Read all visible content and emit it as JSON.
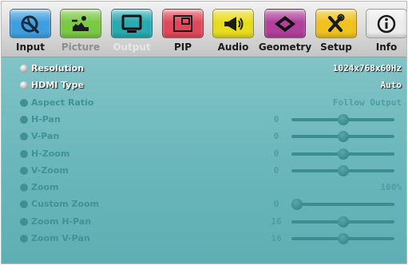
{
  "tabs": [
    {
      "id": "input",
      "label": "Input",
      "icon": "input-arrow-icon",
      "color": "#3e9fe0",
      "state": "normal"
    },
    {
      "id": "picture",
      "label": "Picture",
      "icon": "picture-adjust-icon",
      "color": "#7ac943",
      "state": "dim"
    },
    {
      "id": "output",
      "label": "Output",
      "icon": "monitor-icon",
      "color": "#27aab0",
      "state": "active"
    },
    {
      "id": "pip",
      "label": "PIP",
      "icon": "pip-window-icon",
      "color": "#e0485a",
      "state": "normal"
    },
    {
      "id": "audio",
      "label": "Audio",
      "icon": "speaker-icon",
      "color": "#e8dc1e",
      "state": "normal"
    },
    {
      "id": "geometry",
      "label": "Geometry",
      "icon": "geometry-icon",
      "color": "#b0409b",
      "state": "normal"
    },
    {
      "id": "setup",
      "label": "Setup",
      "icon": "tools-icon",
      "color": "#f0c21e",
      "state": "normal"
    },
    {
      "id": "info",
      "label": "Info",
      "icon": "info-icon",
      "color": "#ececec",
      "state": "normal"
    }
  ],
  "menu": {
    "rows": [
      {
        "name": "Resolution",
        "value": "1024x768x60Hz",
        "enabled": true,
        "type": "value"
      },
      {
        "name": "HDMI Type",
        "value": "Auto",
        "enabled": true,
        "type": "value"
      },
      {
        "name": "Aspect Ratio",
        "value": "Follow Output",
        "enabled": false,
        "type": "value"
      },
      {
        "name": "H-Pan",
        "value": "0",
        "enabled": false,
        "type": "slider",
        "level": 0.5
      },
      {
        "name": "V-Pan",
        "value": "0",
        "enabled": false,
        "type": "slider",
        "level": 0.5
      },
      {
        "name": "H-Zoom",
        "value": "0",
        "enabled": false,
        "type": "slider",
        "level": 0.5
      },
      {
        "name": "V-Zoom",
        "value": "0",
        "enabled": false,
        "type": "slider",
        "level": 0.5
      },
      {
        "name": "Zoom",
        "value": "100%",
        "enabled": false,
        "type": "value"
      },
      {
        "name": "Custom Zoom",
        "value": "0",
        "enabled": false,
        "type": "slider",
        "level": 0.0
      },
      {
        "name": "Zoom H-Pan",
        "value": "16",
        "enabled": false,
        "type": "slider",
        "level": 0.5
      },
      {
        "name": "Zoom V-Pan",
        "value": "16",
        "enabled": false,
        "type": "slider",
        "level": 0.5
      }
    ]
  }
}
